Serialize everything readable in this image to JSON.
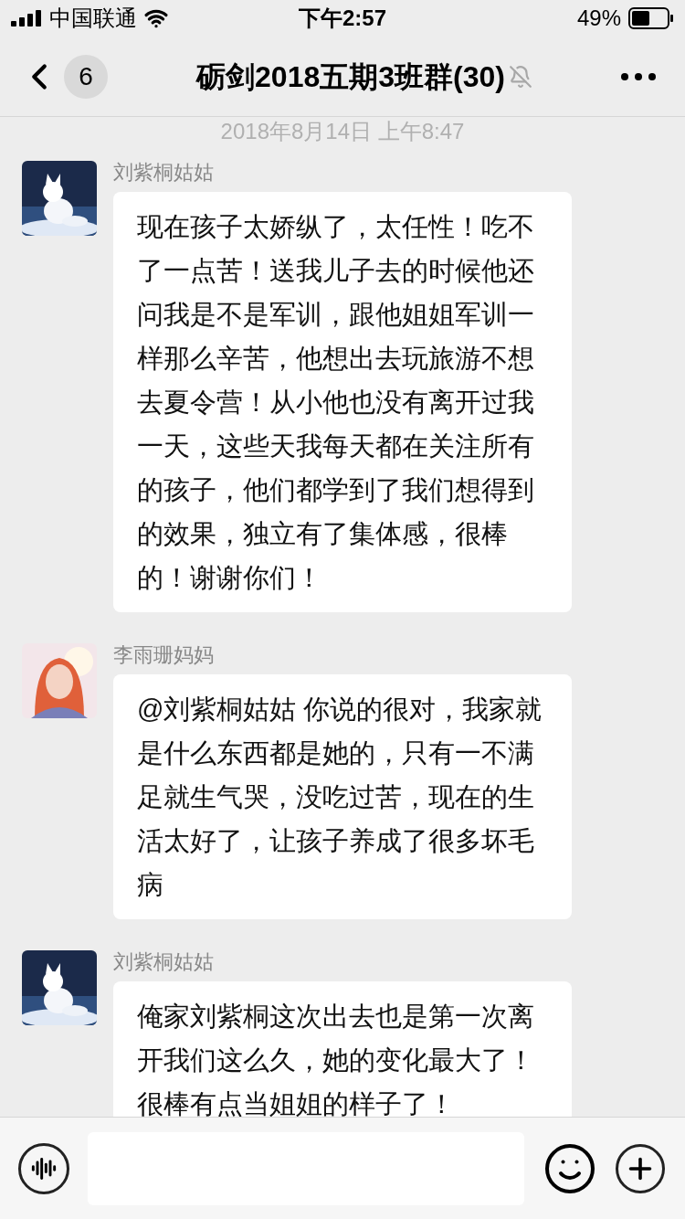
{
  "status_bar": {
    "carrier": "中国联通",
    "time": "下午2:57",
    "battery": "49%"
  },
  "nav": {
    "unread": "6",
    "title": "砺剑2018五期3班群(30)",
    "muted": true
  },
  "timestamp": "2018年8月14日 上午8:47",
  "messages": [
    {
      "sender": "刘紫桐姑姑",
      "avatar": {
        "kind": "fox"
      },
      "text": "现在孩子太娇纵了，太任性！吃不了一点苦！送我儿子去的时候他还问我是不是军训，跟他姐姐军训一样那么辛苦，他想出去玩旅游不想去夏令营！从小他也没有离开过我一天，这些天我每天都在关注所有的孩子，他们都学到了我们想得到的效果，独立有了集体感，很棒的！谢谢你们！"
    },
    {
      "sender": "李雨珊妈妈",
      "avatar": {
        "kind": "person"
      },
      "text": "@刘紫桐姑姑 你说的很对，我家就是什么东西都是她的，只有一不满足就生气哭，没吃过苦，现在的生活太好了，让孩子养成了很多坏毛病"
    },
    {
      "sender": "刘紫桐姑姑",
      "avatar": {
        "kind": "fox"
      },
      "text": "俺家刘紫桐这次出去也是第一次离开我们这么久，她的变化最大了！很棒有点当姐姐的样子了！"
    }
  ]
}
